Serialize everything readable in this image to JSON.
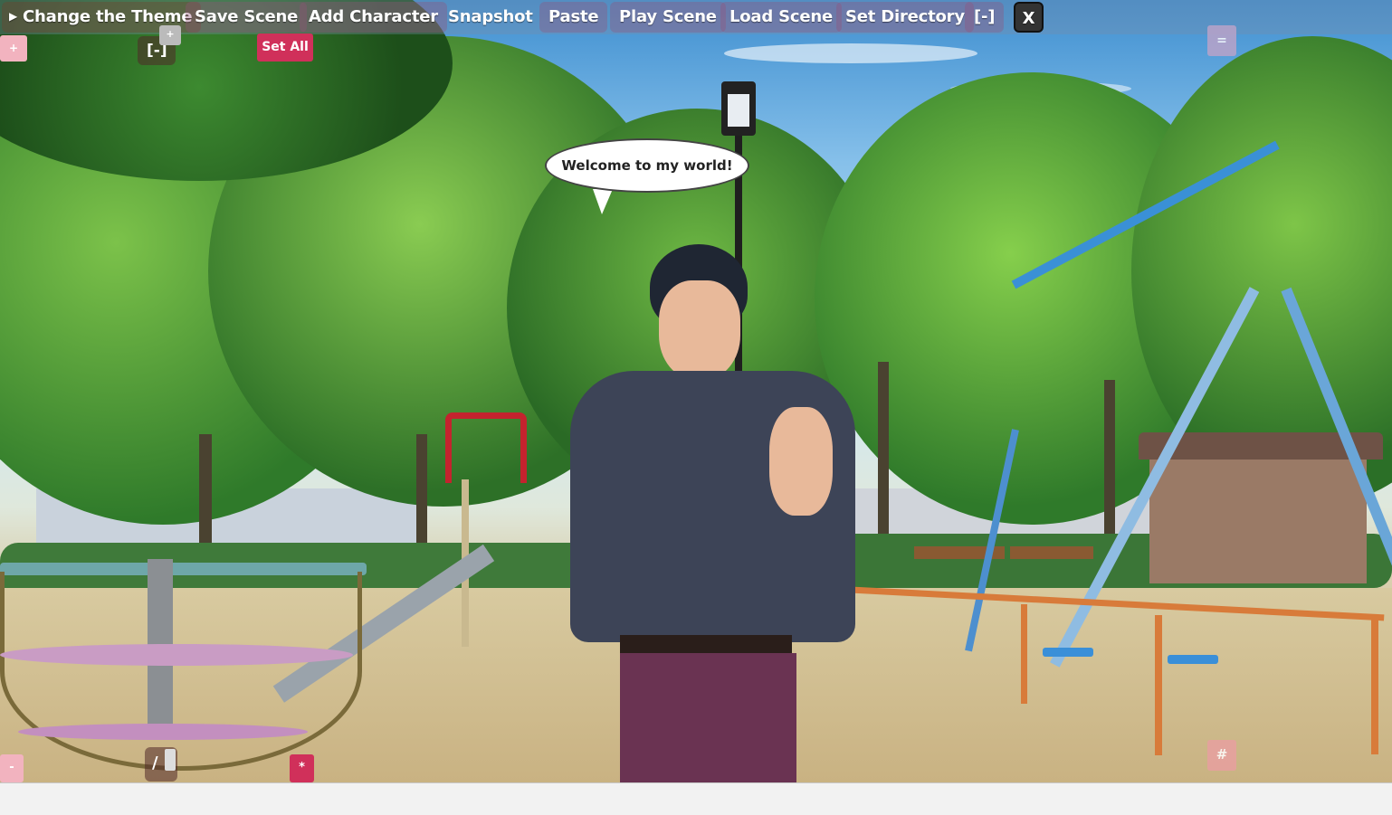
{
  "toolbar": {
    "theme_label": "Change the Theme",
    "save_label": "Save Scene",
    "add_label": "Add Character",
    "snapshot_label": "Snapshot",
    "paste_label": "Paste",
    "play_label": "Play Scene",
    "load_label": "Load Scene",
    "directory_label": "Set Directory",
    "collapse_label": "[-]",
    "close_label": "X"
  },
  "panel": {
    "plus_label": "+",
    "plus_small_label": "+",
    "collapse_label": "[-]",
    "set_all_label": "Set All",
    "equals_label": "=",
    "minus_label": "-",
    "slash_label": "/",
    "star_label": "*",
    "hash_label": "#"
  },
  "scene": {
    "speech_text": "Welcome to my world!"
  },
  "colors": {
    "accent": "#d0305a",
    "pink_light": "#f0a8b4",
    "lavender": "#b9a3c9"
  }
}
